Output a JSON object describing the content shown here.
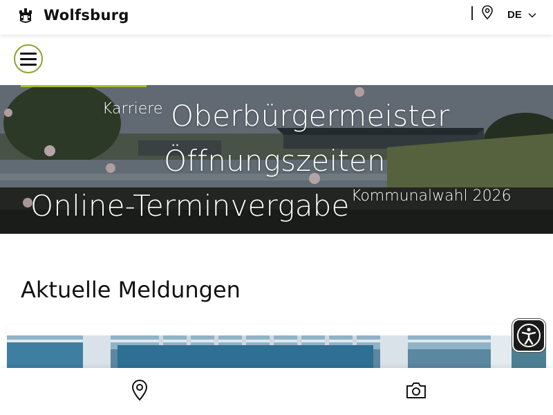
{
  "header": {
    "site_name": "Wolfsburg",
    "language": "DE"
  },
  "icons": {
    "crest": "wolfsburg-crest-icon",
    "location": "location-pin-icon",
    "chevron": "chevron-down-icon",
    "menu": "hamburger-menu-icon",
    "accessibility": "accessibility-icon",
    "camera": "camera-icon"
  },
  "hero": {
    "links": [
      "Karriere",
      "Oberbürgermeister",
      "Öffnungszeiten",
      "Online-Terminvergabe",
      "Kommunalwahl 2026"
    ]
  },
  "main": {
    "section_title": "Aktuelle Meldungen"
  },
  "colors": {
    "accent_green": "#8aa42c",
    "hero_bar": "#a6c02e",
    "text": "#111111",
    "a11y_bg": "#1b1b1b"
  }
}
